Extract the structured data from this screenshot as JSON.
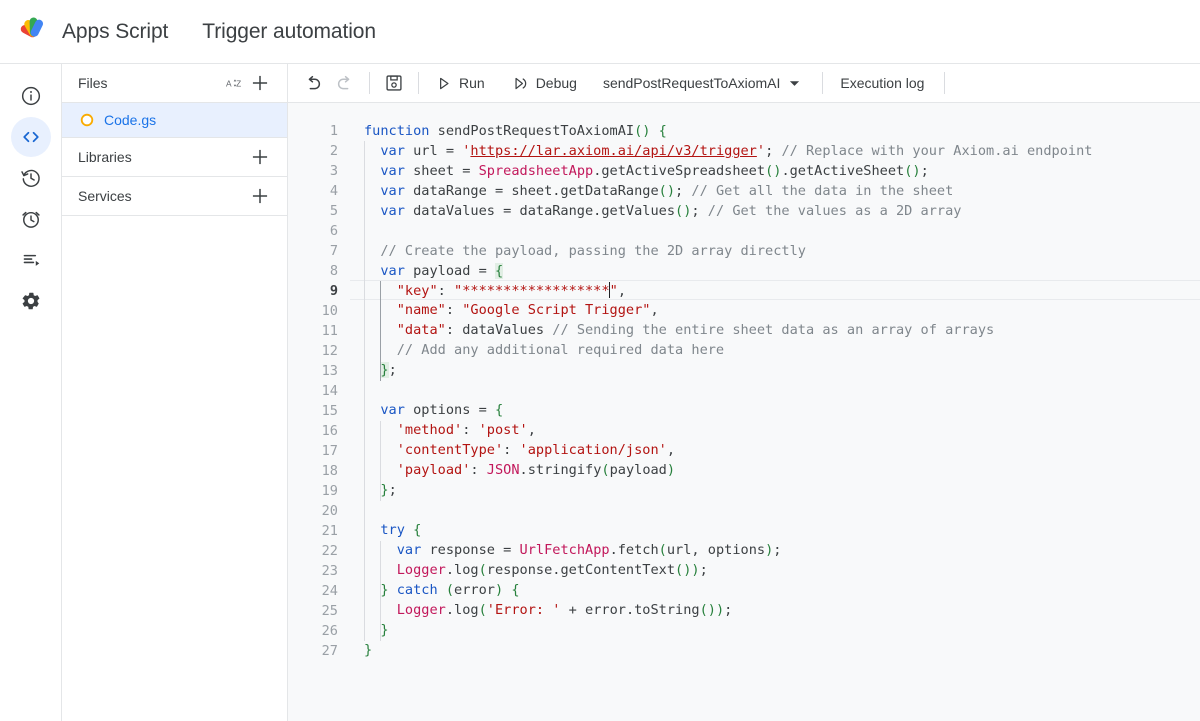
{
  "header": {
    "logo_icon": "apps-script-logo",
    "brand": "Apps Script",
    "project_title": "Trigger automation"
  },
  "rail": {
    "items": [
      {
        "name": "overview",
        "icon": "info-circle-icon",
        "active": false
      },
      {
        "name": "editor",
        "icon": "code-brackets-icon",
        "active": true
      },
      {
        "name": "project-history",
        "icon": "history-clock-icon",
        "active": false
      },
      {
        "name": "triggers",
        "icon": "alarm-clock-icon",
        "active": false
      },
      {
        "name": "executions",
        "icon": "execution-list-icon",
        "active": false
      },
      {
        "name": "settings",
        "icon": "gear-icon",
        "active": false
      }
    ]
  },
  "file_panel": {
    "files_header": {
      "label": "Files",
      "sort_icon": "sort-alpha-icon",
      "add_icon": "plus-icon"
    },
    "files": [
      {
        "name": "Code.gs",
        "icon": "gs-file-circle-icon",
        "selected": true
      }
    ],
    "libraries_header": {
      "label": "Libraries",
      "add_icon": "plus-icon"
    },
    "services_header": {
      "label": "Services",
      "add_icon": "plus-icon"
    }
  },
  "toolbar": {
    "undo": {
      "label": "Undo",
      "icon": "undo-icon",
      "disabled": false
    },
    "redo": {
      "label": "Redo",
      "icon": "redo-icon",
      "disabled": true
    },
    "save": {
      "label": "Save project",
      "icon": "save-disk-icon"
    },
    "run": {
      "label": "Run",
      "icon": "play-triangle-icon"
    },
    "debug": {
      "label": "Debug",
      "icon": "debug-icon"
    },
    "function_select": {
      "value": "sendPostRequestToAxiomAI",
      "icon": "chevron-down-icon"
    },
    "execution_log": {
      "label": "Execution log"
    }
  },
  "colors": {
    "accent_blue": "#1a73e8",
    "selected_row_bg": "#e8f0fe",
    "keyword": "#1a56c4",
    "class_name": "#c2185b",
    "string": "#b31412",
    "comment": "#7f868c",
    "bracket": "#27803c",
    "editor_bg": "#f8f9fa",
    "gutter_text": "#9aa0a6",
    "file_icon_orange": "#f9ab00"
  },
  "editor": {
    "active_line": 9,
    "total_lines": 27,
    "caret_line": 9,
    "language": "javascript",
    "lines": [
      {
        "n": 1,
        "tokens": [
          {
            "t": "kw",
            "v": "function"
          },
          {
            "t": "pl",
            "v": " sendPostRequestToAxiomAI"
          },
          {
            "t": "par",
            "v": "()"
          },
          {
            "t": "pl",
            "v": " "
          },
          {
            "t": "br",
            "v": "{"
          }
        ]
      },
      {
        "n": 2,
        "tokens": [
          {
            "t": "pl",
            "v": "  "
          },
          {
            "t": "kw",
            "v": "var"
          },
          {
            "t": "pl",
            "v": " url = "
          },
          {
            "t": "str",
            "v": "'"
          },
          {
            "t": "strU",
            "v": "https://lar.axiom.ai/api/v3/trigger"
          },
          {
            "t": "str",
            "v": "'"
          },
          {
            "t": "pl",
            "v": "; "
          },
          {
            "t": "com",
            "v": "// Replace with your Axiom.ai endpoint"
          }
        ]
      },
      {
        "n": 3,
        "tokens": [
          {
            "t": "pl",
            "v": "  "
          },
          {
            "t": "kw",
            "v": "var"
          },
          {
            "t": "pl",
            "v": " sheet = "
          },
          {
            "t": "cls",
            "v": "SpreadsheetApp"
          },
          {
            "t": "pl",
            "v": ".getActiveSpreadsheet"
          },
          {
            "t": "par",
            "v": "()"
          },
          {
            "t": "pl",
            "v": ".getActiveSheet"
          },
          {
            "t": "par",
            "v": "()"
          },
          {
            "t": "pl",
            "v": ";"
          }
        ]
      },
      {
        "n": 4,
        "tokens": [
          {
            "t": "pl",
            "v": "  "
          },
          {
            "t": "kw",
            "v": "var"
          },
          {
            "t": "pl",
            "v": " dataRange = sheet.getDataRange"
          },
          {
            "t": "par",
            "v": "()"
          },
          {
            "t": "pl",
            "v": "; "
          },
          {
            "t": "com",
            "v": "// Get all the data in the sheet"
          }
        ]
      },
      {
        "n": 5,
        "tokens": [
          {
            "t": "pl",
            "v": "  "
          },
          {
            "t": "kw",
            "v": "var"
          },
          {
            "t": "pl",
            "v": " dataValues = dataRange.getValues"
          },
          {
            "t": "par",
            "v": "()"
          },
          {
            "t": "pl",
            "v": "; "
          },
          {
            "t": "com",
            "v": "// Get the values as a 2D array"
          }
        ]
      },
      {
        "n": 6,
        "tokens": []
      },
      {
        "n": 7,
        "tokens": [
          {
            "t": "pl",
            "v": "  "
          },
          {
            "t": "com",
            "v": "// Create the payload, passing the 2D array directly"
          }
        ]
      },
      {
        "n": 8,
        "tokens": [
          {
            "t": "pl",
            "v": "  "
          },
          {
            "t": "kw",
            "v": "var"
          },
          {
            "t": "pl",
            "v": " payload = "
          },
          {
            "t": "brhl",
            "v": "{"
          }
        ]
      },
      {
        "n": 9,
        "tokens": [
          {
            "t": "pl",
            "v": "    "
          },
          {
            "t": "str",
            "v": "\"key\""
          },
          {
            "t": "pl",
            "v": ": "
          },
          {
            "t": "str",
            "v": "\"******************"
          },
          {
            "t": "caret",
            "v": ""
          },
          {
            "t": "str",
            "v": "\""
          },
          {
            "t": "pl",
            "v": ","
          }
        ]
      },
      {
        "n": 10,
        "tokens": [
          {
            "t": "pl",
            "v": "    "
          },
          {
            "t": "str",
            "v": "\"name\""
          },
          {
            "t": "pl",
            "v": ": "
          },
          {
            "t": "str",
            "v": "\"Google Script Trigger\""
          },
          {
            "t": "pl",
            "v": ","
          }
        ]
      },
      {
        "n": 11,
        "tokens": [
          {
            "t": "pl",
            "v": "    "
          },
          {
            "t": "str",
            "v": "\"data\""
          },
          {
            "t": "pl",
            "v": ": dataValues "
          },
          {
            "t": "com",
            "v": "// Sending the entire sheet data as an array of arrays"
          }
        ]
      },
      {
        "n": 12,
        "tokens": [
          {
            "t": "pl",
            "v": "    "
          },
          {
            "t": "com",
            "v": "// Add any additional required data here"
          }
        ]
      },
      {
        "n": 13,
        "tokens": [
          {
            "t": "pl",
            "v": "  "
          },
          {
            "t": "brhl",
            "v": "}"
          },
          {
            "t": "pl",
            "v": ";"
          }
        ]
      },
      {
        "n": 14,
        "tokens": []
      },
      {
        "n": 15,
        "tokens": [
          {
            "t": "pl",
            "v": "  "
          },
          {
            "t": "kw",
            "v": "var"
          },
          {
            "t": "pl",
            "v": " options = "
          },
          {
            "t": "br",
            "v": "{"
          }
        ]
      },
      {
        "n": 16,
        "tokens": [
          {
            "t": "pl",
            "v": "    "
          },
          {
            "t": "str",
            "v": "'method'"
          },
          {
            "t": "pl",
            "v": ": "
          },
          {
            "t": "str",
            "v": "'post'"
          },
          {
            "t": "pl",
            "v": ","
          }
        ]
      },
      {
        "n": 17,
        "tokens": [
          {
            "t": "pl",
            "v": "    "
          },
          {
            "t": "str",
            "v": "'contentType'"
          },
          {
            "t": "pl",
            "v": ": "
          },
          {
            "t": "str",
            "v": "'application/json'"
          },
          {
            "t": "pl",
            "v": ","
          }
        ]
      },
      {
        "n": 18,
        "tokens": [
          {
            "t": "pl",
            "v": "    "
          },
          {
            "t": "str",
            "v": "'payload'"
          },
          {
            "t": "pl",
            "v": ": "
          },
          {
            "t": "cls",
            "v": "JSON"
          },
          {
            "t": "pl",
            "v": ".stringify"
          },
          {
            "t": "par",
            "v": "("
          },
          {
            "t": "pl",
            "v": "payload"
          },
          {
            "t": "par",
            "v": ")"
          }
        ]
      },
      {
        "n": 19,
        "tokens": [
          {
            "t": "pl",
            "v": "  "
          },
          {
            "t": "br",
            "v": "}"
          },
          {
            "t": "pl",
            "v": ";"
          }
        ]
      },
      {
        "n": 20,
        "tokens": []
      },
      {
        "n": 21,
        "tokens": [
          {
            "t": "pl",
            "v": "  "
          },
          {
            "t": "kw",
            "v": "try"
          },
          {
            "t": "pl",
            "v": " "
          },
          {
            "t": "br",
            "v": "{"
          }
        ]
      },
      {
        "n": 22,
        "tokens": [
          {
            "t": "pl",
            "v": "    "
          },
          {
            "t": "kw",
            "v": "var"
          },
          {
            "t": "pl",
            "v": " response = "
          },
          {
            "t": "cls",
            "v": "UrlFetchApp"
          },
          {
            "t": "pl",
            "v": ".fetch"
          },
          {
            "t": "par",
            "v": "("
          },
          {
            "t": "pl",
            "v": "url, options"
          },
          {
            "t": "par",
            "v": ")"
          },
          {
            "t": "pl",
            "v": ";"
          }
        ]
      },
      {
        "n": 23,
        "tokens": [
          {
            "t": "pl",
            "v": "    "
          },
          {
            "t": "cls",
            "v": "Logger"
          },
          {
            "t": "pl",
            "v": ".log"
          },
          {
            "t": "par",
            "v": "("
          },
          {
            "t": "pl",
            "v": "response.getContentText"
          },
          {
            "t": "par",
            "v": "()"
          },
          {
            "t": "par",
            "v": ")"
          },
          {
            "t": "pl",
            "v": ";"
          }
        ]
      },
      {
        "n": 24,
        "tokens": [
          {
            "t": "pl",
            "v": "  "
          },
          {
            "t": "br",
            "v": "}"
          },
          {
            "t": "pl",
            "v": " "
          },
          {
            "t": "kw",
            "v": "catch"
          },
          {
            "t": "pl",
            "v": " "
          },
          {
            "t": "par",
            "v": "("
          },
          {
            "t": "pl",
            "v": "error"
          },
          {
            "t": "par",
            "v": ")"
          },
          {
            "t": "pl",
            "v": " "
          },
          {
            "t": "br",
            "v": "{"
          }
        ]
      },
      {
        "n": 25,
        "tokens": [
          {
            "t": "pl",
            "v": "    "
          },
          {
            "t": "cls",
            "v": "Logger"
          },
          {
            "t": "pl",
            "v": ".log"
          },
          {
            "t": "par",
            "v": "("
          },
          {
            "t": "str",
            "v": "'Error: '"
          },
          {
            "t": "pl",
            "v": " + error.toString"
          },
          {
            "t": "par",
            "v": "()"
          },
          {
            "t": "par",
            "v": ")"
          },
          {
            "t": "pl",
            "v": ";"
          }
        ]
      },
      {
        "n": 26,
        "tokens": [
          {
            "t": "pl",
            "v": "  "
          },
          {
            "t": "br",
            "v": "}"
          }
        ]
      },
      {
        "n": 27,
        "tokens": [
          {
            "t": "br",
            "v": "}"
          }
        ]
      }
    ]
  }
}
